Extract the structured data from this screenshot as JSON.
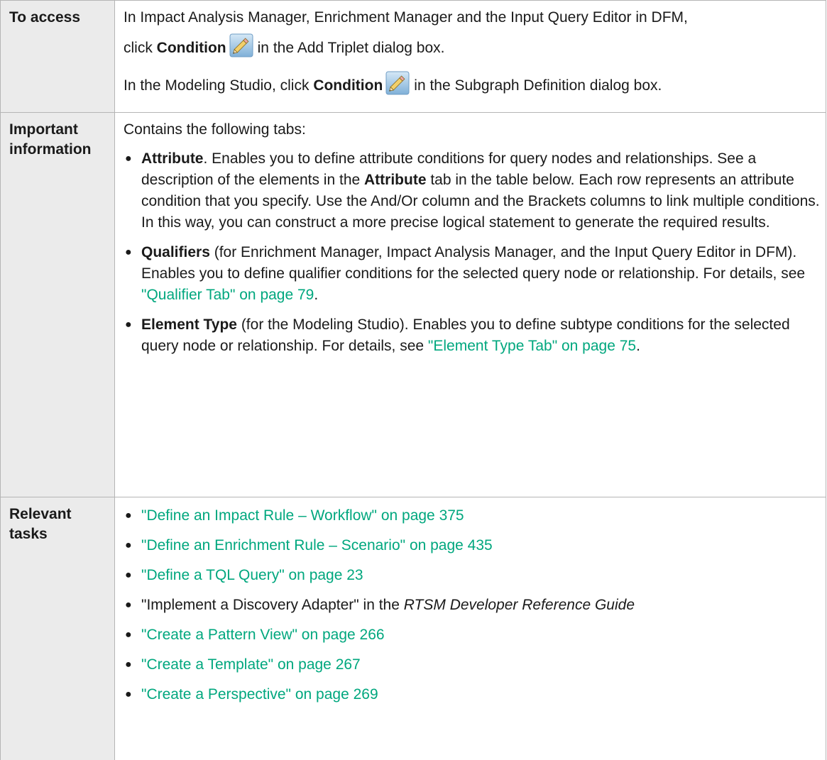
{
  "rows": {
    "access": {
      "label": "To access",
      "line1": "In Impact Analysis Manager, Enrichment Manager and the Input Query Editor in DFM,",
      "line2_pre": "click ",
      "line2_bold": "Condition",
      "line2_post": "in the Add Triplet dialog box.",
      "line3_pre": "In the Modeling Studio, click ",
      "line3_bold": "Condition",
      "line3_post": "in the Subgraph Definition dialog box.",
      "icon": "pencil-icon"
    },
    "info": {
      "label_line1": "Important",
      "label_line2": "information",
      "intro": "Contains the following tabs:",
      "items": [
        {
          "bold": "Attribute",
          "text1": ". Enables you to define attribute conditions for query nodes and relationships. See a description of the elements in the ",
          "bold2": "Attribute",
          "text2": " tab in the table below. Each row represents an attribute condition that you specify. Use the And/Or column and the Brackets columns to link multiple conditions. In this way, you can construct a more precise logical statement to generate the required results."
        },
        {
          "bold": "Qualifiers",
          "text1": " (for Enrichment Manager, Impact Analysis Manager, and the Input Query Editor in DFM). Enables you to define qualifier conditions for the selected query node or relationship. For details, see ",
          "link": "\"Qualifier Tab\" on page 79",
          "text2": "."
        },
        {
          "bold": "Element Type",
          "text1": " (for the Modeling Studio). Enables you to define subtype conditions for the selected query node or relationship. For details, see ",
          "link": "\"Element Type Tab\" on page 75",
          "text2": "."
        }
      ]
    },
    "tasks": {
      "label_line1": "Relevant",
      "label_line2": "tasks",
      "links": [
        "\"Define an Impact Rule – Workflow\" on page 375",
        "\"Define an Enrichment Rule – Scenario\" on page 435",
        "\"Define a TQL Query\" on page 23"
      ],
      "plain_item_pre": "\"Implement a Discovery Adapter\" in the ",
      "plain_item_italic": "RTSM Developer Reference Guide",
      "links2": [
        "\"Create a Pattern View\" on page 266",
        "\"Create a Template\" on page 267",
        "\"Create a Perspective\" on page 269"
      ]
    }
  },
  "colors": {
    "link": "#00a77e",
    "label_background": "#ebebeb",
    "border": "#b5b5b5"
  }
}
